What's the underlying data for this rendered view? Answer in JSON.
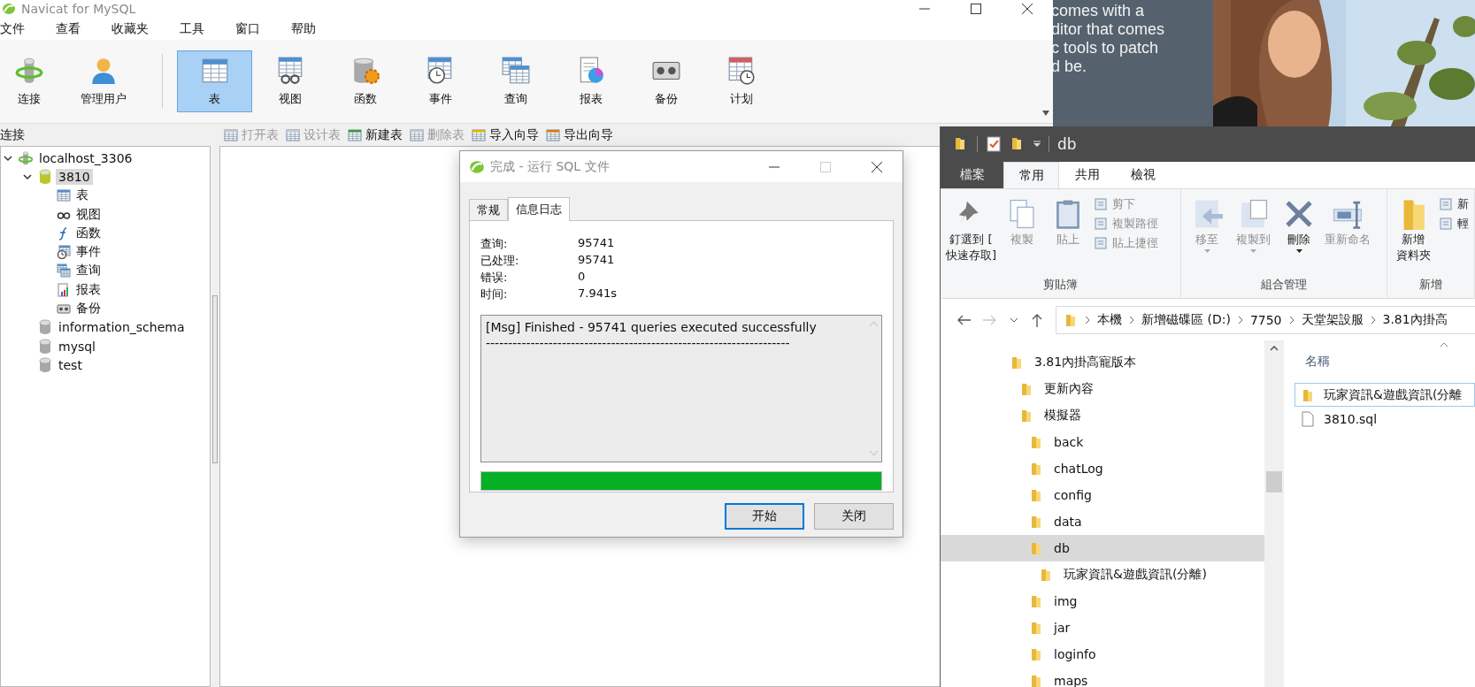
{
  "desktop": {
    "banner_text": [
      "comes with a",
      "ditor that comes",
      "c tools to patch",
      "d be."
    ],
    "photo": {
      "kind": "picture"
    }
  },
  "navicat": {
    "title": "Navicat for MySQL",
    "menu": [
      "文件",
      "查看",
      "收藏夹",
      "工具",
      "窗口",
      "帮助"
    ],
    "toolbar": [
      {
        "label": "连接",
        "selected": false
      },
      {
        "label": "管理用户",
        "selected": false
      },
      {
        "label": "表",
        "selected": true
      },
      {
        "label": "视图",
        "selected": false
      },
      {
        "label": "函数",
        "selected": false
      },
      {
        "label": "事件",
        "selected": false
      },
      {
        "label": "查询",
        "selected": false
      },
      {
        "label": "报表",
        "selected": false
      },
      {
        "label": "备份",
        "selected": false
      },
      {
        "label": "计划",
        "selected": false
      }
    ],
    "object_toolbar": [
      {
        "label": "打开表",
        "disabled": true
      },
      {
        "label": "设计表",
        "disabled": true
      },
      {
        "label": "新建表",
        "disabled": false
      },
      {
        "label": "删除表",
        "disabled": true
      },
      {
        "label": "导入向导",
        "disabled": false
      },
      {
        "label": "导出向导",
        "disabled": false
      }
    ],
    "sidebar": {
      "title": "连接",
      "tree": [
        {
          "label": "localhost_3306",
          "kind": "connection",
          "expanded": true,
          "selected": false,
          "children": [
            {
              "label": "3810",
              "kind": "database",
              "open": true,
              "expanded": true,
              "selected": true,
              "children": [
                {
                  "label": "表",
                  "kind": "object",
                  "selected": false
                },
                {
                  "label": "视图",
                  "kind": "object",
                  "selected": false
                },
                {
                  "label": "函数",
                  "kind": "object",
                  "selected": false
                },
                {
                  "label": "事件",
                  "kind": "object",
                  "selected": false
                },
                {
                  "label": "查询",
                  "kind": "object",
                  "selected": false
                },
                {
                  "label": "报表",
                  "kind": "object",
                  "selected": false
                },
                {
                  "label": "备份",
                  "kind": "object",
                  "selected": false
                }
              ]
            },
            {
              "label": "information_schema",
              "kind": "database",
              "open": false,
              "selected": false
            },
            {
              "label": "mysql",
              "kind": "database",
              "open": false,
              "selected": false
            },
            {
              "label": "test",
              "kind": "database",
              "open": false,
              "selected": false
            }
          ]
        }
      ]
    }
  },
  "dialog": {
    "title": "完成 - 运行 SQL 文件",
    "tabs": [
      {
        "label": "常规",
        "selected": false
      },
      {
        "label": "信息日志",
        "selected": true
      }
    ],
    "stats": [
      {
        "label": "查询:",
        "value": "95741"
      },
      {
        "label": "已处理:",
        "value": "95741"
      },
      {
        "label": "错误:",
        "value": "0"
      },
      {
        "label": "时间:",
        "value": "7.941s"
      }
    ],
    "log": [
      "[Msg] Finished - 95741 queries executed successfully",
      "--------------------------------------------------------------------"
    ],
    "progress": {
      "level": 1
    },
    "buttons": [
      {
        "label": "开始",
        "default": true
      },
      {
        "label": "关闭",
        "default": false
      }
    ]
  },
  "explorer": {
    "title": "db",
    "ribbon_tabs": [
      {
        "label": "檔案",
        "kind": "file",
        "selected": false
      },
      {
        "label": "常用",
        "kind": "tab",
        "selected": true
      },
      {
        "label": "共用",
        "kind": "tab",
        "selected": false
      },
      {
        "label": "檢視",
        "kind": "tab",
        "selected": false
      }
    ],
    "ribbon_groups": [
      {
        "label": "剪貼簿",
        "commands": [
          {
            "kind": "large",
            "lines": [
              "釘選到 [",
              "快速存取]"
            ],
            "disabled": false,
            "dropdown": false
          },
          {
            "kind": "large",
            "lines": [
              "複製"
            ],
            "disabled": true,
            "dropdown": false
          },
          {
            "kind": "large",
            "lines": [
              "貼上"
            ],
            "disabled": true,
            "dropdown": false
          },
          {
            "kind": "stack",
            "items": [
              {
                "label": "剪下",
                "disabled": true
              },
              {
                "label": "複製路徑",
                "disabled": true
              },
              {
                "label": "貼上捷徑",
                "disabled": true
              }
            ]
          }
        ]
      },
      {
        "label": "組合管理",
        "commands": [
          {
            "kind": "large",
            "lines": [
              "移至"
            ],
            "disabled": true,
            "dropdown": true
          },
          {
            "kind": "large",
            "lines": [
              "複製到"
            ],
            "disabled": true,
            "dropdown": true
          },
          {
            "kind": "large",
            "lines": [
              "刪除"
            ],
            "disabled": false,
            "dropdown": true
          },
          {
            "kind": "large",
            "lines": [
              "重新命名"
            ],
            "disabled": true,
            "dropdown": false
          }
        ]
      },
      {
        "label": "新增",
        "commands": [
          {
            "kind": "large",
            "lines": [
              "新增",
              "資料夾"
            ],
            "disabled": false,
            "dropdown": false
          },
          {
            "kind": "stack",
            "items": [
              {
                "label": "新",
                "disabled": false
              },
              {
                "label": "輕",
                "disabled": false
              }
            ]
          }
        ]
      }
    ],
    "address": [
      "本機",
      "新增磁碟區 (D:)",
      "7750",
      "天堂架設服",
      "3.81內掛高"
    ],
    "nav_tree": [
      {
        "label": "3.81內掛高寵版本",
        "selected": false,
        "children": [
          {
            "label": "更新內容",
            "selected": false
          },
          {
            "label": "模擬器",
            "selected": false,
            "children": [
              {
                "label": "back",
                "selected": false
              },
              {
                "label": "chatLog",
                "selected": false
              },
              {
                "label": "config",
                "selected": false
              },
              {
                "label": "data",
                "selected": false
              },
              {
                "label": "db",
                "selected": true,
                "children": [
                  {
                    "label": "玩家資訊&遊戲資訊(分離)",
                    "selected": false
                  }
                ]
              },
              {
                "label": "img",
                "selected": false
              },
              {
                "label": "jar",
                "selected": false
              },
              {
                "label": "loginfo",
                "selected": false
              },
              {
                "label": "maps",
                "selected": false
              }
            ]
          }
        ]
      }
    ],
    "file_list": {
      "column": "名稱",
      "items": [
        {
          "label": "玩家資訊&遊戲資訊(分離",
          "kind": "folder",
          "focused": true
        },
        {
          "label": "3810.sql",
          "kind": "file",
          "focused": false
        }
      ]
    }
  }
}
